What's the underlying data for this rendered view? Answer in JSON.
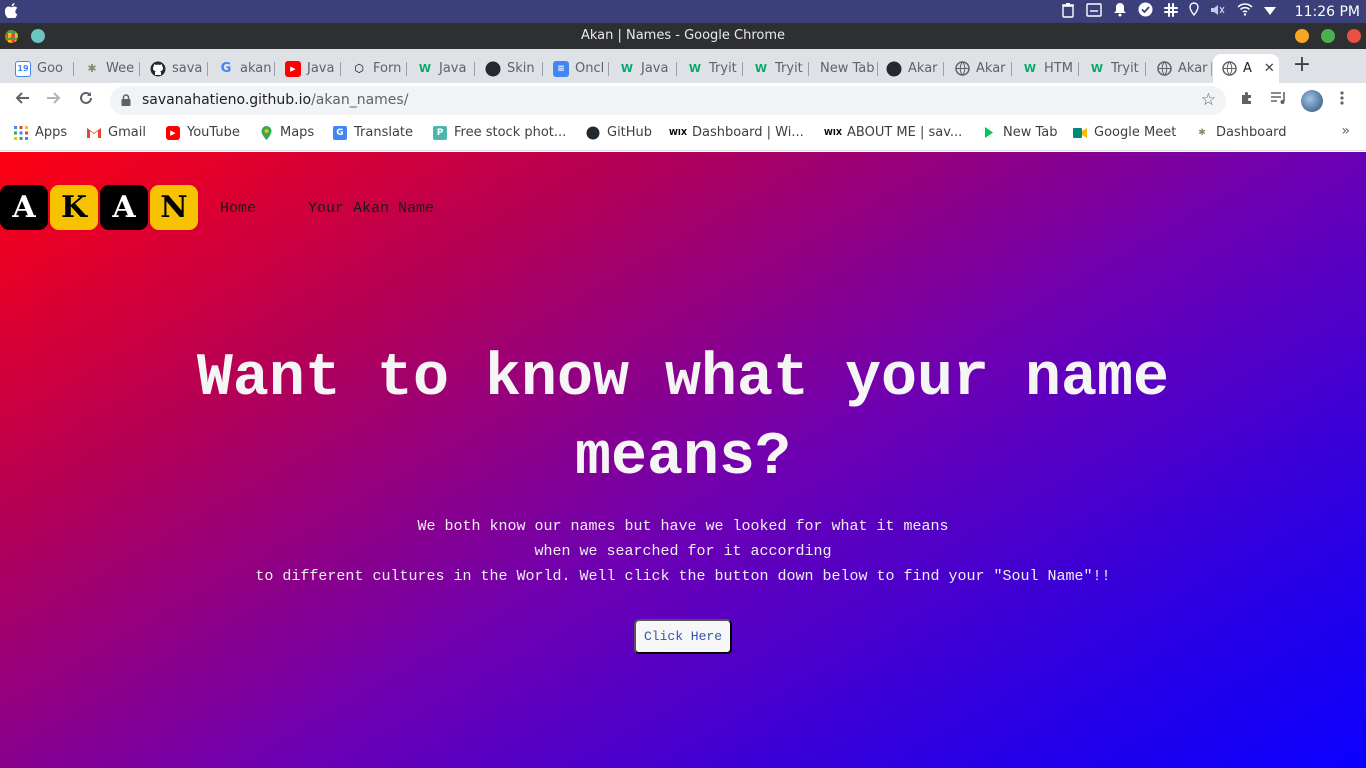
{
  "system_bar": {
    "time": "11:26 PM",
    "icons": [
      "trash-icon",
      "window-icon",
      "bell-icon",
      "check-circle-icon",
      "slack-icon",
      "location-icon",
      "volume-icon",
      "wifi-icon",
      "dropdown-icon"
    ]
  },
  "window": {
    "title": "Akan | Names - Google Chrome"
  },
  "tabs": [
    {
      "label": "Goo",
      "icon": "google-calendar-icon"
    },
    {
      "label": "Wee",
      "icon": "palm-icon"
    },
    {
      "label": "sava",
      "icon": "github-icon"
    },
    {
      "label": "akan",
      "icon": "google-icon"
    },
    {
      "label": "Java",
      "icon": "youtube-icon"
    },
    {
      "label": "Forn",
      "icon": "codepen-icon"
    },
    {
      "label": "Java",
      "icon": "w3schools-icon"
    },
    {
      "label": "Skin",
      "icon": "github-icon"
    },
    {
      "label": "Oncl",
      "icon": "docs-icon"
    },
    {
      "label": "Java",
      "icon": "w3schools-icon"
    },
    {
      "label": "Tryit",
      "icon": "w3schools-icon"
    },
    {
      "label": "Tryit",
      "icon": "w3schools-icon"
    },
    {
      "label": "New Tab",
      "icon": ""
    },
    {
      "label": "Akar",
      "icon": "github-icon"
    },
    {
      "label": "Akar",
      "icon": "globe-icon"
    },
    {
      "label": "HTM",
      "icon": "w3schools-icon"
    },
    {
      "label": "Tryit",
      "icon": "w3schools-icon"
    },
    {
      "label": "Akar",
      "icon": "globe-icon"
    },
    {
      "label": "A",
      "icon": "globe-icon"
    }
  ],
  "toolbar": {
    "url_host": "savanahatieno.github.io",
    "url_path": "/akan_names/"
  },
  "bookmarks": [
    {
      "label": "Apps",
      "icon": "apps-grid-icon"
    },
    {
      "label": "Gmail",
      "icon": "gmail-icon"
    },
    {
      "label": "YouTube",
      "icon": "youtube-icon"
    },
    {
      "label": "Maps",
      "icon": "maps-icon"
    },
    {
      "label": "Translate",
      "icon": "translate-icon"
    },
    {
      "label": "Free stock phot...",
      "icon": "stock-photo-icon"
    },
    {
      "label": "GitHub",
      "icon": "github-icon"
    },
    {
      "label": "Dashboard | Wi...",
      "icon": "wix-icon"
    },
    {
      "label": "ABOUT ME | sav...",
      "icon": "wix-icon"
    },
    {
      "label": "New Tab",
      "icon": "play-icon"
    },
    {
      "label": "Google Meet",
      "icon": "meet-icon"
    },
    {
      "label": "Dashboard",
      "icon": "palm-icon"
    }
  ],
  "page": {
    "logo_letters": [
      "A",
      "K",
      "A",
      "N"
    ],
    "nav": {
      "home": "Home",
      "your_name": "Your Akan Name"
    },
    "hero_line1": "Want to know what your name",
    "hero_line2": "means?",
    "sub_line1": "We both know our names but have we looked for what it means",
    "sub_line2": "when we searched for it according",
    "sub_line3": "to different cultures in the World. Well click the button down below to find your \"Soul Name\"!!",
    "cta_label": "Click Here"
  }
}
